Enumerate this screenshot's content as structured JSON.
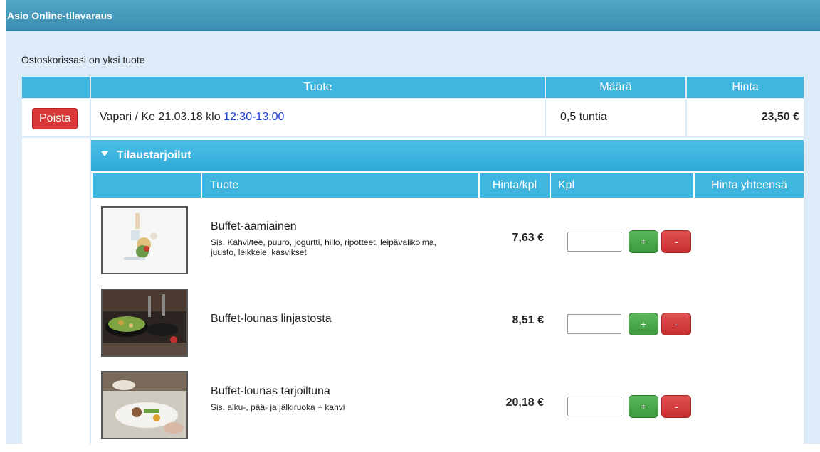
{
  "window": {
    "title": "Asio Online-tilavaraus"
  },
  "cart": {
    "message": "Ostoskorissasi on yksi tuote",
    "headers": {
      "product": "Tuote",
      "quantity": "Määrä",
      "price": "Hinta"
    },
    "row": {
      "remove_label": "Poista",
      "product_prefix": "Vapari / Ke 21.03.18 klo ",
      "time": "12:30-13:00",
      "quantity": "0,5 tuntia",
      "price": "23,50 €"
    }
  },
  "catering": {
    "title": "Tilaustarjoilut",
    "headers": {
      "product": "Tuote",
      "unit_price": "Hinta/kpl",
      "count": "Kpl",
      "total": "Hinta yhteensä"
    },
    "items": [
      {
        "name": "Buffet-aamiainen",
        "description": "Sis. Kahvi/tee, puuro, jogurtti, hillo, ripotteet, leipävalikoima, juusto, leikkele, kasvikset",
        "price": "7,63 €",
        "count": "",
        "plus": "+",
        "minus": "-"
      },
      {
        "name": "Buffet-lounas linjastosta",
        "description": "",
        "price": "8,51 €",
        "count": "",
        "plus": "+",
        "minus": "-"
      },
      {
        "name": "Buffet-lounas tarjoiltuna",
        "description": "Sis. alku-, pää- ja jälkiruoka + kahvi",
        "price": "20,18 €",
        "count": "",
        "plus": "+",
        "minus": "-"
      }
    ]
  },
  "colors": {
    "header_blue": "#3fb6e0",
    "title_bar": "#4a9cc0",
    "remove_red": "#d93838",
    "add_green": "#4cae4c",
    "time_link": "#1a3ec9"
  },
  "icons": {
    "section_toggle": "caret-down-icon"
  }
}
